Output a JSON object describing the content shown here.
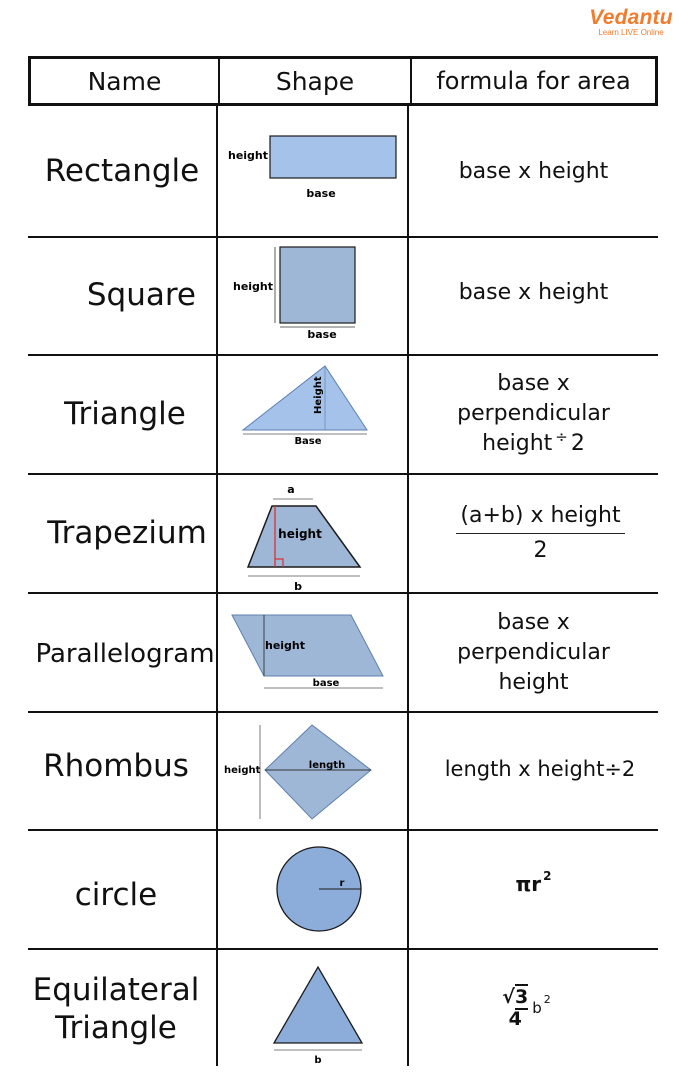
{
  "brand": {
    "name": "Vedantu",
    "tagline": "Learn LIVE Online"
  },
  "header": {
    "name": "Name",
    "shape": "Shape",
    "formula": "formula for area"
  },
  "rows": [
    {
      "name": "Rectangle",
      "formula": "base x height",
      "labels": {
        "height": "height",
        "base": "base"
      }
    },
    {
      "name": "Square",
      "formula": "base x height",
      "labels": {
        "height": "height",
        "base": "base"
      }
    },
    {
      "name": "Triangle",
      "formula_lines": [
        "base x",
        "perpendicular",
        "height",
        "÷",
        "2"
      ],
      "labels": {
        "height": "Height",
        "base": "Base"
      }
    },
    {
      "name": "Trapezium",
      "formula_num": "(a+b) x height",
      "formula_den": "2",
      "labels": {
        "a": "a",
        "height": "height",
        "b": "b"
      }
    },
    {
      "name": "Parallelogram",
      "formula_lines": [
        "base x",
        "perpendicular",
        "height"
      ],
      "labels": {
        "height": "height",
        "base": "base"
      }
    },
    {
      "name": "Rhombus",
      "formula": "length x height÷2",
      "labels": {
        "height": "height",
        "length": "length"
      }
    },
    {
      "name": "circle",
      "formula_pi": "π",
      "formula_r": "r",
      "formula_exp": "2",
      "labels": {
        "r": "r"
      }
    },
    {
      "name_lines": [
        "Equilateral",
        "Triangle"
      ],
      "formula_root": "√",
      "formula_three": "3",
      "formula_four": "4",
      "formula_b": "b",
      "formula_exp": "2",
      "labels": {
        "b": "b"
      }
    }
  ],
  "colors": {
    "fill_light": "#a4c2ea",
    "fill_mid": "#9fb7d6",
    "stroke": "#1a1a1a",
    "accent_red": "#d9322d",
    "brand_orange": "#f07c2f"
  }
}
